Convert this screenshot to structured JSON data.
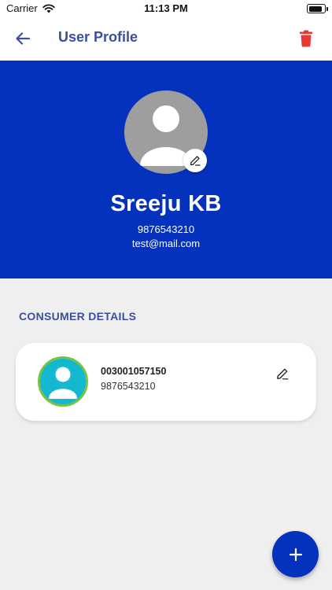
{
  "status_bar": {
    "carrier": "Carrier",
    "time": "11:13 PM",
    "battery_level": 0.9
  },
  "app_bar": {
    "title": "User Profile",
    "back_icon": "arrow-left-icon",
    "delete_icon": "trash-icon"
  },
  "profile": {
    "name": "Sreeju KB",
    "phone": "9876543210",
    "email": "test@mail.com",
    "avatar_icon": "person-icon",
    "edit_icon": "pencil-icon"
  },
  "consumer_section": {
    "title": "CONSUMER DETAILS",
    "consumers": [
      {
        "number": "003001057150",
        "phone": "9876543210",
        "avatar_icon": "person-icon",
        "edit_icon": "pencil-icon"
      }
    ]
  },
  "fab": {
    "icon": "plus-icon"
  },
  "colors": {
    "primary": "#0432bd",
    "title_text": "#3a4fa0",
    "delete": "#e53935",
    "background": "#efefef",
    "avatar_grey": "#9e9e9e",
    "consumer_avatar_bg": "#15b8d1",
    "consumer_avatar_border": "#76c442"
  }
}
